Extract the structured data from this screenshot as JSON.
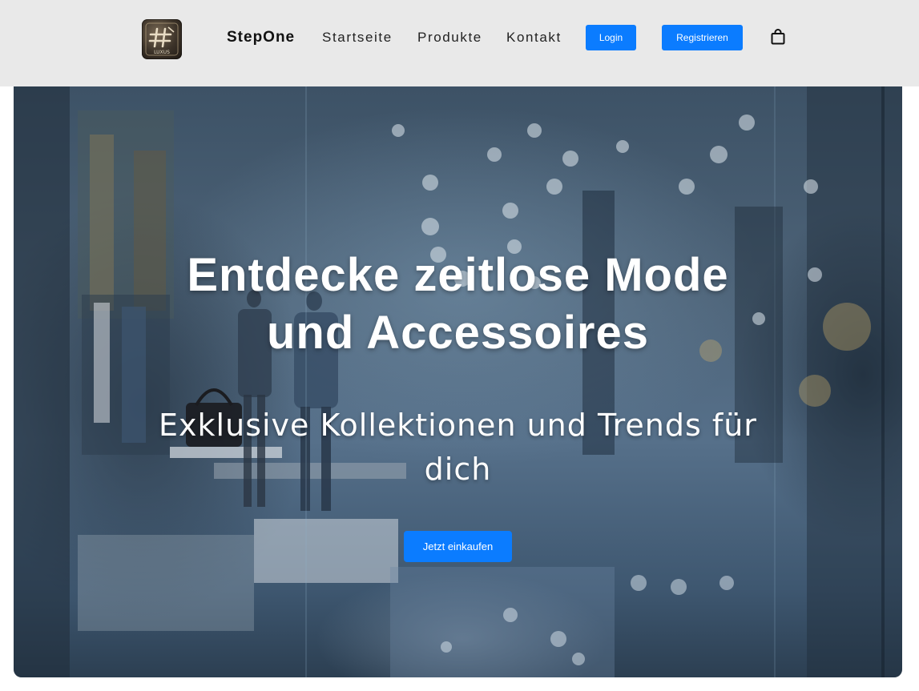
{
  "header": {
    "logo_text": "LUXUS",
    "brand": "StepOne",
    "nav": [
      {
        "label": "Startseite"
      },
      {
        "label": "Produkte"
      },
      {
        "label": "Kontakt"
      }
    ],
    "login_label": "Login",
    "register_label": "Registrieren",
    "cart_icon": "shopping-bag-icon"
  },
  "hero": {
    "title_line1": "Entdecke zeitlose Mode",
    "title_line2": "und Accessoires",
    "subtitle_line1": "Exklusive Kollektionen und Trends für",
    "subtitle_line2": "dich",
    "cta_label": "Jetzt einkaufen",
    "background": "blurred-fashion-boutique-interior-photo"
  },
  "colors": {
    "accent": "#0b7cff",
    "navbar_bg": "#e9e9e9",
    "hero_text": "#ffffff"
  }
}
